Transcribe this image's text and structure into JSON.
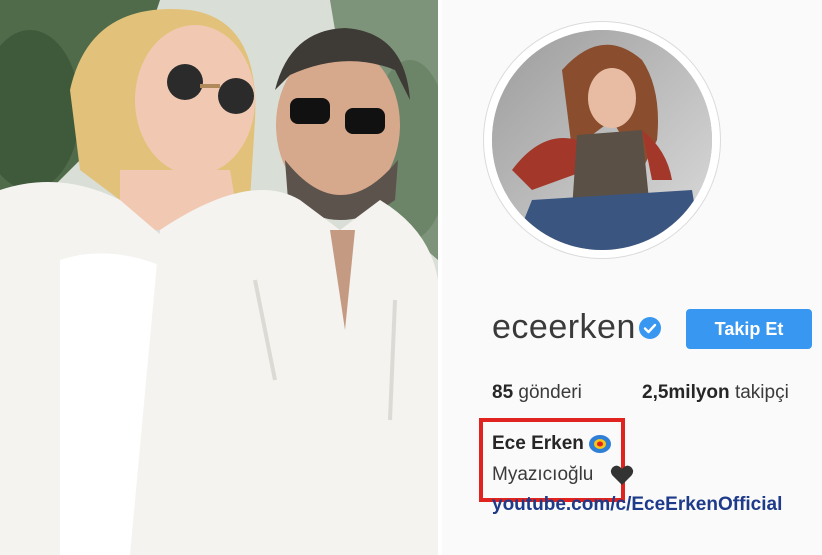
{
  "profile": {
    "username": "eceerken",
    "verified": true,
    "follow_label": "Takip Et",
    "posts_count": "85",
    "posts_label": "gönderi",
    "followers_count": "2,5milyon",
    "followers_label": "takipçi",
    "full_name": "Ece Erken",
    "bio_line": "Myazıcıoğlu",
    "link": "youtube.com/c/EceErkenOfficial"
  },
  "colors": {
    "accent_blue": "#3897f0",
    "highlight_red": "#e0231f",
    "verified_blue": "#3897f0",
    "link_blue": "#1e3a8a"
  },
  "icons": {
    "verified": "verified-badge-icon",
    "emoji": "sun-emoji-icon",
    "heart": "black-heart-icon"
  }
}
